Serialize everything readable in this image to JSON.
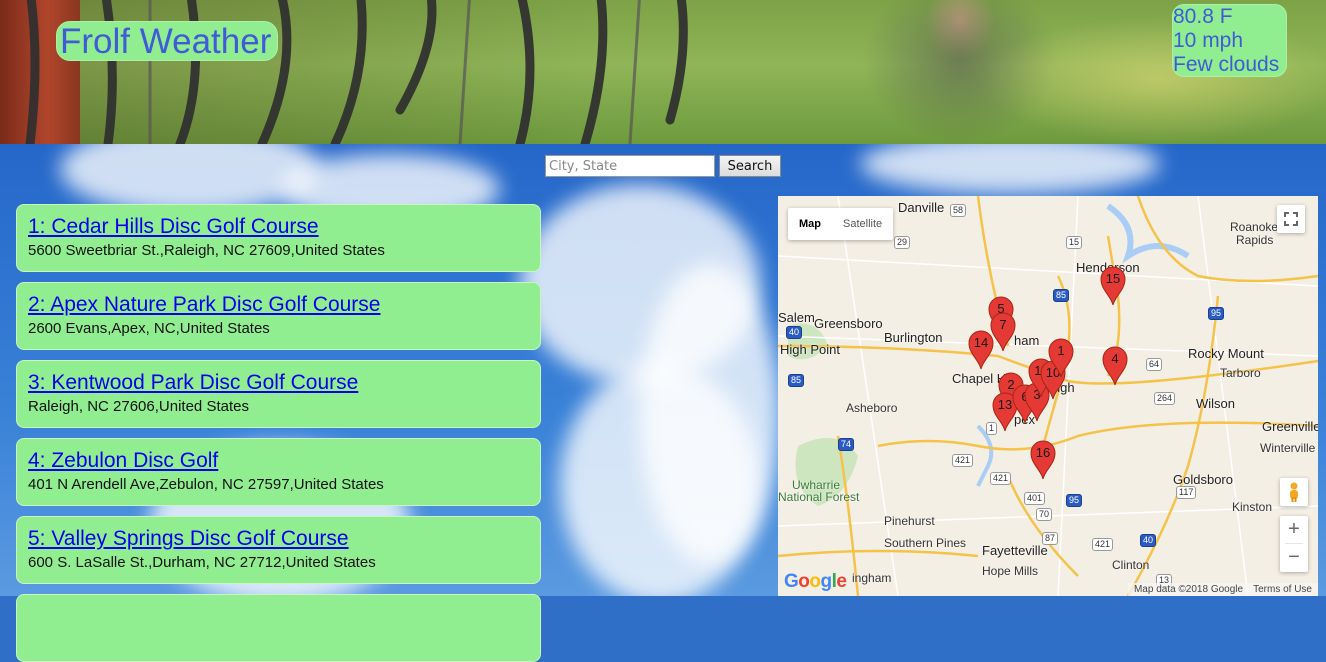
{
  "header": {
    "title": "Frolf Weather",
    "weather": {
      "temperature": "80.8 F",
      "wind": "10 mph",
      "conditions": "Few clouds"
    }
  },
  "search": {
    "placeholder": "City, State",
    "value": "",
    "button_label": "Search"
  },
  "courses": [
    {
      "title": "1: Cedar Hills Disc Golf Course ",
      "address": "5600 Sweetbriar St.,Raleigh, NC 27609,United States"
    },
    {
      "title": "2: Apex Nature Park Disc Golf Course ",
      "address": "2600 Evans,Apex, NC,United States"
    },
    {
      "title": "3: Kentwood Park Disc Golf Course ",
      "address": "Raleigh, NC 27606,United States"
    },
    {
      "title": "4: Zebulon Disc Golf ",
      "address": "401 N Arendell Ave,Zebulon, NC 27597,United States"
    },
    {
      "title": "5: Valley Springs Disc Golf Course ",
      "address": "600 S. LaSalle St.,Durham, NC 27712,United States"
    }
  ],
  "map": {
    "type_buttons": {
      "map": "Map",
      "satellite": "Satellite"
    },
    "zoom_in": "+",
    "zoom_out": "−",
    "fullscreen_icon": "fullscreen-icon",
    "pegman_icon": "pegman-icon",
    "google_logo": "Google",
    "attribution": {
      "data": "Map data ©2018 Google",
      "terms": "Terms of Use"
    },
    "marker_color": "#e53935",
    "markers": [
      "1",
      "2",
      "3",
      "4",
      "5",
      "6",
      "7",
      "10",
      "11",
      "13",
      "14",
      "15",
      "16"
    ],
    "places": {
      "danville": "Danville",
      "roanoke_rapids": "Roanoke",
      "roanoke_rapids_2": "Rapids",
      "henderson": "Henderson",
      "greensboro": "Greensboro",
      "burlington": "Burlington",
      "high_point": "High Point",
      "salem": "Salem",
      "chapel_hill": "Chapel H",
      "durham": "ham",
      "raleigh": "eigh",
      "rocky_mount": "Rocky Mount",
      "tarboro": "Tarboro",
      "asheboro": "Asheboro",
      "wilson": "Wilson",
      "greenville": "Greenville",
      "winterville": "Winterville",
      "uwharrie": "Uwharrie",
      "national_forest": "National Forest",
      "goldsboro": "Goldsboro",
      "kinston": "Kinston",
      "pinehurst": "Pinehurst",
      "southern_pines": "Southern Pines",
      "fayetteville": "Fayetteville",
      "hope_mills": "Hope Mills",
      "clinton": "Clinton",
      "lumberton_partial": "ingham",
      "apex_partial": "pex"
    },
    "shields": [
      "58",
      "29",
      "15",
      "85",
      "95",
      "40",
      "70",
      "64",
      "85",
      "264",
      "74",
      "1",
      "421",
      "401",
      "95",
      "421",
      "117",
      "70",
      "40",
      "87",
      "421",
      "13"
    ]
  },
  "colors": {
    "card_bg": "#90ee90",
    "title_text": "#3f5bd8",
    "link": "#0000ee"
  }
}
